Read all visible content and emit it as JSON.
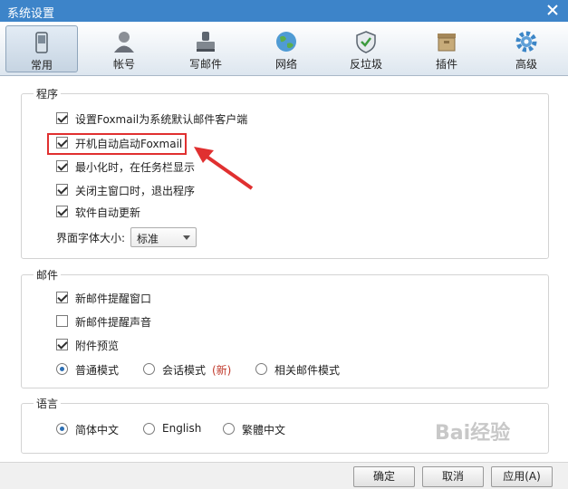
{
  "window": {
    "title": "系统设置"
  },
  "tabs": [
    {
      "label": "常用",
      "icon": "phone-icon",
      "active": true
    },
    {
      "label": "帐号",
      "icon": "user-icon"
    },
    {
      "label": "写邮件",
      "icon": "stamp-icon"
    },
    {
      "label": "网络",
      "icon": "globe-icon"
    },
    {
      "label": "反垃圾",
      "icon": "shield-icon"
    },
    {
      "label": "插件",
      "icon": "box-icon"
    },
    {
      "label": "高级",
      "icon": "gear-icon"
    }
  ],
  "program": {
    "title": "程序",
    "options": [
      {
        "label": "设置Foxmail为系统默认邮件客户端",
        "checked": true
      },
      {
        "label": "开机自动启动Foxmail",
        "checked": true
      },
      {
        "label": "最小化时，在任务栏显示",
        "checked": true
      },
      {
        "label": "关闭主窗口时，退出程序",
        "checked": true
      },
      {
        "label": "软件自动更新",
        "checked": true
      }
    ],
    "font_size_label": "界面字体大小:",
    "font_size_value": "标准"
  },
  "mail": {
    "title": "邮件",
    "options": [
      {
        "label": "新邮件提醒窗口",
        "checked": true
      },
      {
        "label": "新邮件提醒声音",
        "checked": false
      },
      {
        "label": "附件预览",
        "checked": true
      }
    ],
    "modes": [
      {
        "label": "普通模式",
        "selected": true
      },
      {
        "label": "会话模式",
        "badge": "(新)",
        "selected": false
      },
      {
        "label": "相关邮件模式",
        "selected": false
      }
    ]
  },
  "language": {
    "title": "语言",
    "options": [
      {
        "label": "简体中文",
        "selected": true
      },
      {
        "label": "English",
        "selected": false
      },
      {
        "label": "繁體中文",
        "selected": false
      }
    ]
  },
  "footer": {
    "ok": "确定",
    "cancel": "取消",
    "apply": "应用(A)"
  },
  "watermark": "Bai经验",
  "colors": {
    "titlebar": "#3d84c9",
    "highlight": "#e03030"
  }
}
